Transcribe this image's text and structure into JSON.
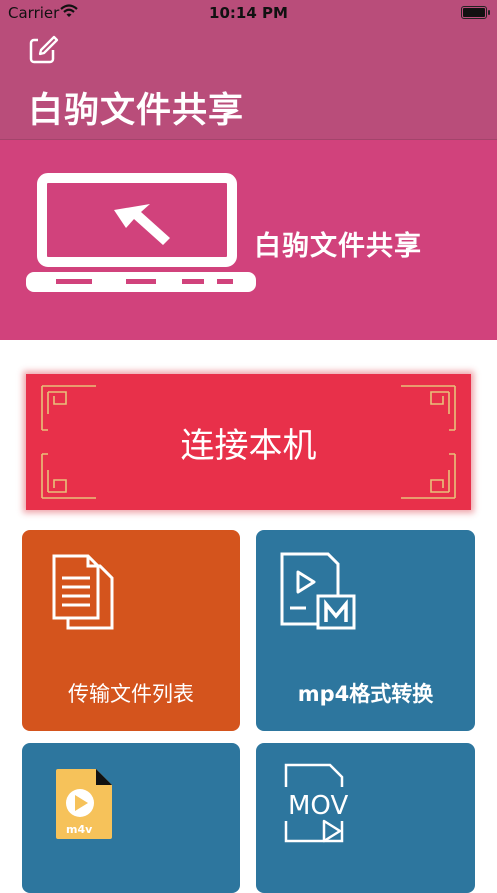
{
  "status_bar": {
    "carrier": "Carrier",
    "time": "10:14 PM"
  },
  "header": {
    "title": "白驹文件共享"
  },
  "banner": {
    "text": "白驹文件共享"
  },
  "connect_button": {
    "label": "连接本机"
  },
  "tiles": [
    {
      "label": "传输文件列表",
      "color": "#d4541d"
    },
    {
      "label": "mp4格式转换",
      "color": "#2d769e"
    },
    {
      "label": "",
      "icon_text": "m4v",
      "color": "#2d769e"
    },
    {
      "label": "",
      "icon_text": "MOV",
      "color": "#2d769e"
    }
  ],
  "colors": {
    "header": "#b94d7a",
    "banner": "#d1427c",
    "connect": "#e8304a",
    "tile_blue": "#2d769e",
    "tile_orange": "#d4541d"
  }
}
